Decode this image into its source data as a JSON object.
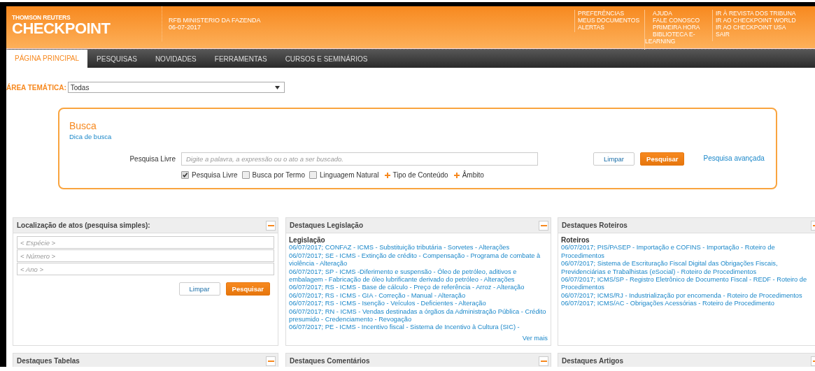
{
  "header": {
    "brand_top": "THOMSON REUTERS",
    "brand": "CHECKPOINT",
    "account": [
      "RFB MINISTERIO DA FAZENDA",
      "06-07-2017"
    ],
    "link_columns": [
      [
        "PREFERÊNCIAS",
        "MEUS DOCUMENTOS",
        "ALERTAS"
      ],
      [
        "AJUDA",
        "FALE CONOSCO",
        "PRIMEIRA HORA",
        "BIBLIOTECA E-LEARNING"
      ],
      [
        "IR À REVISTA DOS TRIBUNA",
        "IR AO CHECKPOINT WORLD",
        "IR AO CHECKPOINT USA",
        "SAIR"
      ]
    ]
  },
  "tabs": [
    {
      "label": "PÁGINA PRINCIPAL",
      "selected": true
    },
    {
      "label": "PESQUISAS",
      "selected": false
    },
    {
      "label": "NOVIDADES",
      "selected": false
    },
    {
      "label": "FERRAMENTAS",
      "selected": false
    },
    {
      "label": "CURSOS E SEMINÁRIOS",
      "selected": false
    }
  ],
  "area_tematica": {
    "label": "ÁREA TEMÁTICA:",
    "value": "Todas"
  },
  "busca": {
    "title": "Busca",
    "tip_link": "Dica de busca",
    "field_label": "Pesquisa Livre",
    "placeholder": "Digite a palavra, a expressão ou o ato a ser buscado.",
    "options": [
      {
        "label": "Pesquisa Livre",
        "checked": true
      },
      {
        "label": "Busca por Termo",
        "checked": false
      },
      {
        "label": "Linguagem Natural",
        "checked": false
      }
    ],
    "expanders": [
      "Tipo de Conteúdo",
      "Âmbito"
    ],
    "clear_button": "Limpar",
    "search_button": "Pesquisar",
    "advanced_link": "Pesquisa avançada"
  },
  "panels": [
    {
      "title": "Localização de atos (pesquisa simples):",
      "kind": "form",
      "placeholders": [
        "< Espécie >",
        "< Número >",
        "< Ano >"
      ],
      "clear_button": "Limpar",
      "search_button": "Pesquisar"
    },
    {
      "title": "Destaques Legislação",
      "kind": "list",
      "subtitle": "Legislação",
      "items": [
        "06/07/2017; CONFAZ - ICMS - Substituição tributária - Sorvetes - Alterações",
        "06/07/2017; SE - ICMS - Extinção de crédito - Compensação - Programa de combate à violência - Alteração",
        "06/07/2017; SP - ICMS -Diferimento e suspensão - Óleo de petróleo, aditivos e embalagem - Fabricação de óleo lubrificante derivado do petróleo - Alterações",
        "06/07/2017; RS - ICMS - Base de cálculo - Preço de referência - Arroz - Alteração",
        "06/07/2017; RS - ICMS - GIA - Correção - Manual - Alteração",
        "06/07/2017; RS - ICMS - Isenção - Veículos - Deficientes - Alteração",
        "06/07/2017; RN - ICMS - Vendas destinadas a órgãos da Administração Pública - Crédito presumido - Credenciamento - Revogação",
        "06/07/2017; PE - ICMS - Incentivo fiscal - Sistema de Incentivo à Cultura (SIC) -"
      ],
      "more_link": "Ver mais"
    },
    {
      "title": "Destaques Roteiros",
      "kind": "list",
      "subtitle": "Roteiros",
      "items": [
        "06/07/2017; PIS/PASEP - Importação e COFINS - Importação - Roteiro de Procedimentos",
        "06/07/2017; Sistema de Escrituração Fiscal Digital das Obrigações Fiscais, Previdenciárias e Trabalhistas (eSocial) - Roteiro de Procedimentos",
        "06/07/2017; ICMS/SP - Registro Eletrônico de Documento Fiscal - REDF - Roteiro de Procedimentos",
        "06/07/2017; ICMS/RJ - Industrialização por encomenda - Roteiro de Procedimentos",
        "06/07/2017; ICMS/AC - Obrigações Acessórias - Roteiro de Procedimento"
      ]
    },
    {
      "title": "Destaques Tabelas",
      "kind": "header"
    },
    {
      "title": "Destaques Comentários",
      "kind": "header"
    },
    {
      "title": "Destaques Artigos",
      "kind": "header"
    }
  ]
}
